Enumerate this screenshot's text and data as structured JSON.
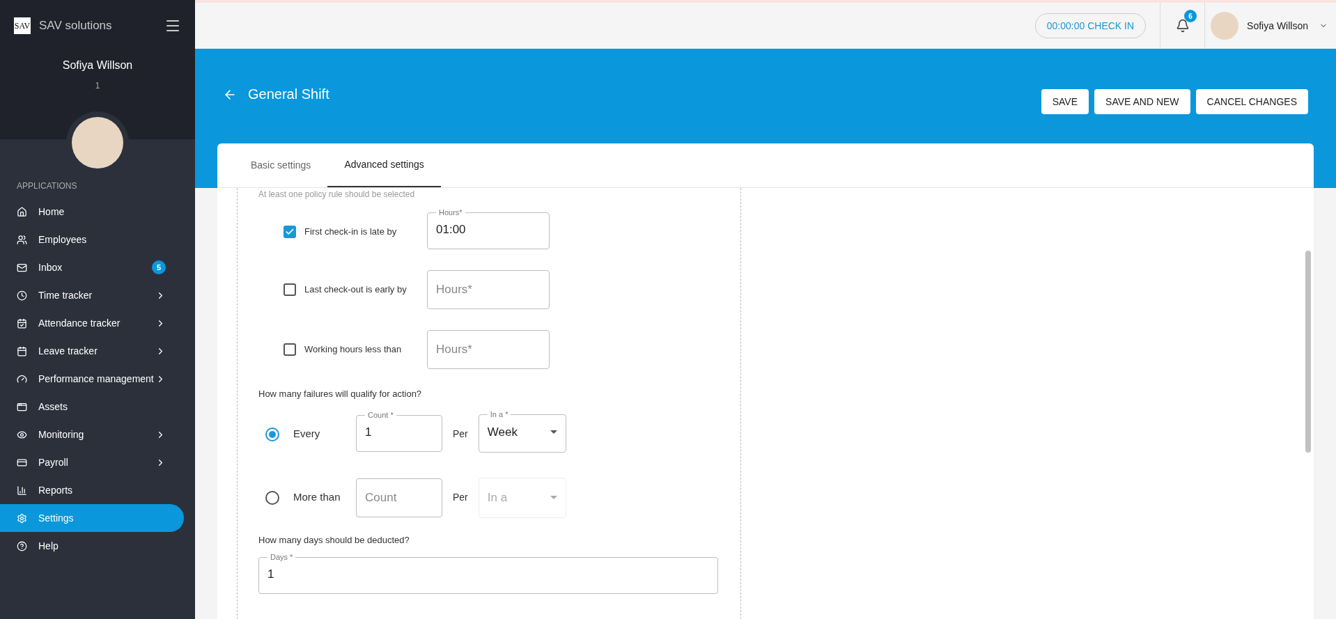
{
  "sidebar": {
    "logo": "SAV",
    "brand": "SAV solutions",
    "user_name": "Sofiya Willson",
    "user_id": "1",
    "section_title": "APPLICATIONS",
    "items": [
      {
        "label": "Home",
        "has_submenu": false,
        "selected": false
      },
      {
        "label": "Employees",
        "has_submenu": false,
        "selected": false
      },
      {
        "label": "Inbox",
        "badge": "5",
        "has_submenu": false,
        "selected": false
      },
      {
        "label": "Time tracker",
        "has_submenu": true,
        "selected": false
      },
      {
        "label": "Attendance tracker",
        "has_submenu": true,
        "selected": false
      },
      {
        "label": "Leave tracker",
        "has_submenu": true,
        "selected": false
      },
      {
        "label": "Performance management",
        "has_submenu": true,
        "selected": false
      },
      {
        "label": "Assets",
        "has_submenu": false,
        "selected": false
      },
      {
        "label": "Monitoring",
        "has_submenu": true,
        "selected": false
      },
      {
        "label": "Payroll",
        "has_submenu": true,
        "selected": false
      },
      {
        "label": "Reports",
        "has_submenu": false,
        "selected": false
      },
      {
        "label": "Settings",
        "has_submenu": false,
        "selected": true
      },
      {
        "label": "Help",
        "has_submenu": false,
        "selected": false
      }
    ]
  },
  "topbar": {
    "check_in": "00:00:00 CHECK IN",
    "notification_count": "6",
    "user_name": "Sofiya Willson"
  },
  "header": {
    "title": "General Shift",
    "buttons": [
      "SAVE",
      "SAVE AND NEW",
      "CANCEL CHANGES"
    ]
  },
  "tabs": [
    {
      "label": "Basic settings",
      "selected": false
    },
    {
      "label": "Advanced settings",
      "selected": true
    }
  ],
  "form": {
    "hint": "At least one policy rule should be selected",
    "rules": [
      {
        "label": "First check-in is late by",
        "checked": true,
        "field_label": "Hours*",
        "value": "01:00"
      },
      {
        "label": "Last check-out is early by",
        "checked": false,
        "placeholder": "Hours*"
      },
      {
        "label": "Working hours less than",
        "checked": false,
        "placeholder": "Hours*"
      }
    ],
    "failures_question": "How many failures will qualify for action?",
    "failure_options": [
      {
        "label": "Every",
        "selected": true,
        "count_label": "Count *",
        "count_value": "1",
        "per": "Per",
        "period_label": "In a *",
        "period_value": "Week",
        "disabled": false
      },
      {
        "label": "More than",
        "selected": false,
        "count_placeholder": "Count",
        "per": "Per",
        "period_placeholder": "In a",
        "disabled": true
      }
    ],
    "days_question": "How many days should be deducted?",
    "days_field": {
      "label": "Days *",
      "value": "1"
    }
  }
}
